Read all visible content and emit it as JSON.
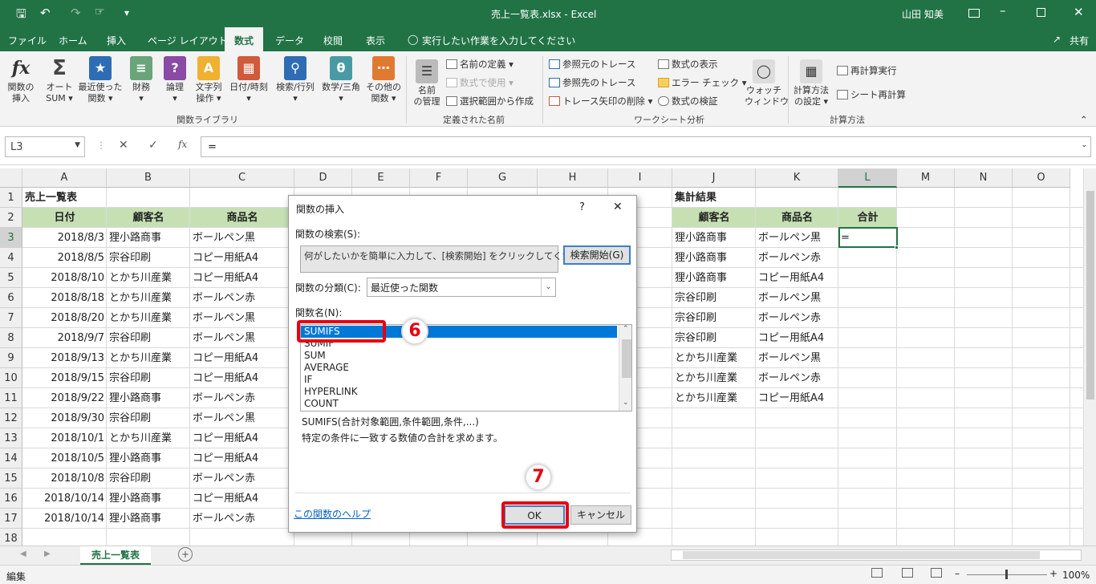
{
  "titlebar": {
    "title": "売上一覧表.xlsx  -  Excel",
    "user": "山田 知美",
    "save_icon": "save-icon",
    "undo_icon": "undo-icon",
    "redo_icon": "redo-icon",
    "touch_icon": "touch-mode-icon",
    "qat_more": "▾"
  },
  "menu": {
    "tabs": [
      "ファイル",
      "ホーム",
      "挿入",
      "ページ レイアウト",
      "数式",
      "データ",
      "校閲",
      "表示"
    ],
    "active_tab": "数式",
    "tell_me": "実行したい作業を入力してください",
    "share": "共有"
  },
  "ribbon": {
    "insert_function": "関数の\n挿入",
    "autosum": "オート\nSUM ▾",
    "recent": "最近使った\n関数 ▾",
    "financial": "財務\n▾",
    "logical": "論理\n▾",
    "text": "文字列\n操作 ▾",
    "datetime": "日付/時刻\n▾",
    "lookup": "検索/行列\n▾",
    "math": "数学/三角\n▾",
    "more": "その他の\n関数 ▾",
    "group_library": "関数ライブラリ",
    "name_manager": "名前\nの管理",
    "define_name": "名前の定義 ▾",
    "use_in_formula": "数式で使用 ▾",
    "create_from_selection": "選択範囲から作成",
    "group_names": "定義された名前",
    "trace_precedents": "参照元のトレース",
    "trace_dependents": "参照先のトレース",
    "remove_arrows": "トレース矢印の削除 ▾",
    "show_formulas": "数式の表示",
    "error_check": "エラー チェック ▾",
    "evaluate_formula": "数式の検証",
    "watch_window": "ウォッチ\nウィンドウ",
    "group_audit": "ワークシート分析",
    "calc_options": "計算方法\nの設定 ▾",
    "calc_now": "再計算実行",
    "calc_sheet": "シート再計算",
    "group_calc": "計算方法"
  },
  "formula_bar": {
    "name_box": "L3",
    "cancel": "✕",
    "enter": "✓",
    "fx": "fx",
    "formula": "="
  },
  "columns": [
    "A",
    "B",
    "C",
    "D",
    "E",
    "F",
    "G",
    "H",
    "I",
    "J",
    "K",
    "L",
    "M",
    "N",
    "O"
  ],
  "rows": [
    "1",
    "2",
    "3",
    "4",
    "5",
    "6",
    "7",
    "8",
    "9",
    "10",
    "11",
    "12",
    "13",
    "14",
    "15",
    "16",
    "17",
    "18"
  ],
  "sheet": {
    "title": "売上一覧表",
    "headers": [
      "日付",
      "顧客名",
      "商品名"
    ],
    "data": [
      [
        "2018/8/3",
        "狸小路商事",
        "ボールペン黒"
      ],
      [
        "2018/8/5",
        "宗谷印刷",
        "コピー用紙A4"
      ],
      [
        "2018/8/10",
        "とかち川産業",
        "コピー用紙A4"
      ],
      [
        "2018/8/18",
        "とかち川産業",
        "ボールペン赤"
      ],
      [
        "2018/8/20",
        "とかち川産業",
        "ボールペン黒"
      ],
      [
        "2018/9/7",
        "宗谷印刷",
        "ボールペン黒"
      ],
      [
        "2018/9/13",
        "とかち川産業",
        "コピー用紙A4"
      ],
      [
        "2018/9/15",
        "宗谷印刷",
        "コピー用紙A4"
      ],
      [
        "2018/9/22",
        "狸小路商事",
        "ボールペン赤"
      ],
      [
        "2018/9/30",
        "宗谷印刷",
        "ボールペン黒"
      ],
      [
        "2018/10/1",
        "とかち川産業",
        "コピー用紙A4"
      ],
      [
        "2018/10/5",
        "狸小路商事",
        "コピー用紙A4"
      ],
      [
        "2018/10/8",
        "宗谷印刷",
        "ボールペン赤"
      ],
      [
        "2018/10/14",
        "狸小路商事",
        "コピー用紙A4"
      ],
      [
        "2018/10/14",
        "狸小路商事",
        "ボールペン赤"
      ]
    ],
    "summary_title": "集計結果",
    "summary_headers": [
      "顧客名",
      "商品名",
      "合計"
    ],
    "summary": [
      [
        "狸小路商事",
        "ボールペン黒",
        "="
      ],
      [
        "狸小路商事",
        "ボールペン赤",
        ""
      ],
      [
        "狸小路商事",
        "コピー用紙A4",
        ""
      ],
      [
        "宗谷印刷",
        "ボールペン黒",
        ""
      ],
      [
        "宗谷印刷",
        "ボールペン赤",
        ""
      ],
      [
        "宗谷印刷",
        "コピー用紙A4",
        ""
      ],
      [
        "とかち川産業",
        "ボールペン黒",
        ""
      ],
      [
        "とかち川産業",
        "ボールペン赤",
        ""
      ],
      [
        "とかち川産業",
        "コピー用紙A4",
        ""
      ]
    ]
  },
  "dialog": {
    "title": "関数の挿入",
    "help": "?",
    "close": "✕",
    "search_label": "関数の検索(S):",
    "search_text": "何がしたいかを簡単に入力して、[検索開始] をクリックしてください。",
    "search_button": "検索開始(G)",
    "category_label": "関数の分類(C):",
    "category_value": "最近使った関数",
    "name_label": "関数名(N):",
    "functions": [
      "SUMIFS",
      "SUMIF",
      "SUM",
      "AVERAGE",
      "IF",
      "HYPERLINK",
      "COUNT"
    ],
    "selected": "SUMIFS",
    "syntax": "SUMIFS(合計対象範囲,条件範囲,条件,...)",
    "description": "特定の条件に一致する数値の合計を求めます。",
    "help_link": "この関数のヘルプ",
    "ok": "OK",
    "cancel": "キャンセル"
  },
  "annotations": {
    "step6": "6",
    "step7": "7",
    "color": "#e60012"
  },
  "sheet_tab": "売上一覧表",
  "status": {
    "mode": "編集",
    "zoom": "100%"
  },
  "colors": {
    "excel_green": "#217346",
    "header_fill": "#c6e0b4",
    "selection": "#0078d7"
  }
}
